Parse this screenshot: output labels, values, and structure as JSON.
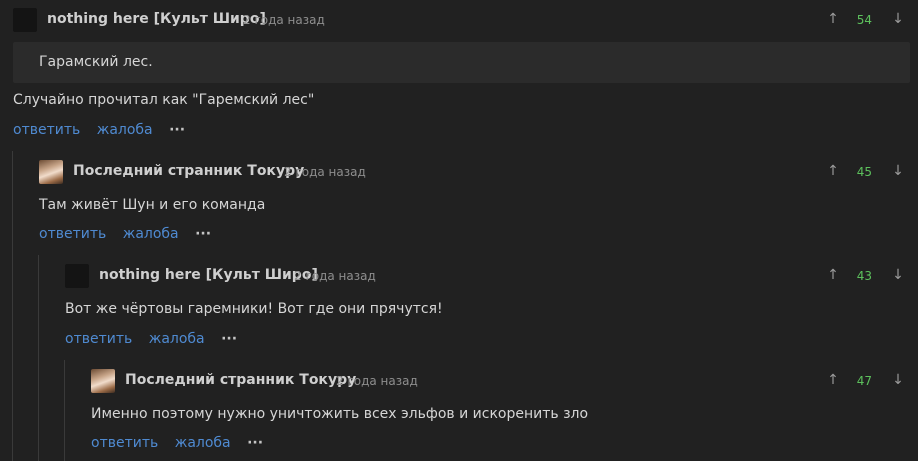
{
  "comments": [
    {
      "author": "nothing here [Культ Широ]",
      "time": "2 года назад",
      "score": "54",
      "quote": "Гарамский лес.",
      "text": "Случайно прочитал как  \"Гаремский лес\"",
      "reply_label": "ответить",
      "report_label": "жалоба",
      "more_label": "···"
    },
    {
      "author": "Последний странник Токуру",
      "time": "2 года назад",
      "score": "45",
      "text": "Там живёт Шун и его команда",
      "reply_label": "ответить",
      "report_label": "жалоба",
      "more_label": "···"
    },
    {
      "author": "nothing here [Культ Широ]",
      "time": "2 года назад",
      "score": "43",
      "text": "Вот же чёртовы гаремники!  Вот где они прячутся!",
      "reply_label": "ответить",
      "report_label": "жалоба",
      "more_label": "···"
    },
    {
      "author": "Последний странник Токуру",
      "time": "2 года назад",
      "score": "47",
      "text": "Именно поэтому нужно уничтожить всех эльфов и искоренить зло",
      "reply_label": "ответить",
      "report_label": "жалоба",
      "more_label": "···"
    }
  ],
  "icons": {
    "upvote": "upvote-arrow-icon",
    "downvote": "downvote-arrow-icon",
    "more": "more-dots-icon"
  },
  "colors": {
    "background": "#212121",
    "link": "#4f8ad1",
    "score": "#5cc05c",
    "quote_bg": "#2b2b2b"
  }
}
